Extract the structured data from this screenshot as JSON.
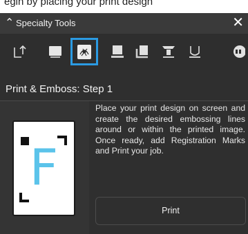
{
  "top_strip": {
    "text": "egin by placing your print design"
  },
  "panel": {
    "title": "Specialty Tools",
    "step_title": "Print & Emboss: Step 1",
    "description": "Place your print design on screen and create the desired embossing lines around or within the printed image. Once ready, add Registration Marks and Print your job.",
    "print_label": "Print",
    "preview_letter": "F"
  },
  "tools": [
    {
      "name": "tool-engrave",
      "icon": "engrave-arrow-icon",
      "selected": false
    },
    {
      "name": "tool-deboss",
      "icon": "deboss-block-icon",
      "selected": false
    },
    {
      "name": "tool-print-emboss",
      "icon": "print-emboss-icon",
      "selected": true
    },
    {
      "name": "tool-emboss-stand",
      "icon": "emboss-stand-icon",
      "selected": false
    },
    {
      "name": "tool-wave",
      "icon": "wave-tool-icon",
      "selected": false
    },
    {
      "name": "tool-foil",
      "icon": "foil-tool-icon",
      "selected": false
    },
    {
      "name": "tool-perforate",
      "icon": "perforate-tool-icon",
      "selected": false
    },
    {
      "name": "tool-more",
      "icon": "more-tool-icon",
      "selected": false
    }
  ],
  "colors": {
    "accent_selected": "#2b9be3",
    "preview_letter": "#5bc3ea",
    "panel_bg": "#2f2f2f",
    "header_bg": "#3a3a3a"
  }
}
